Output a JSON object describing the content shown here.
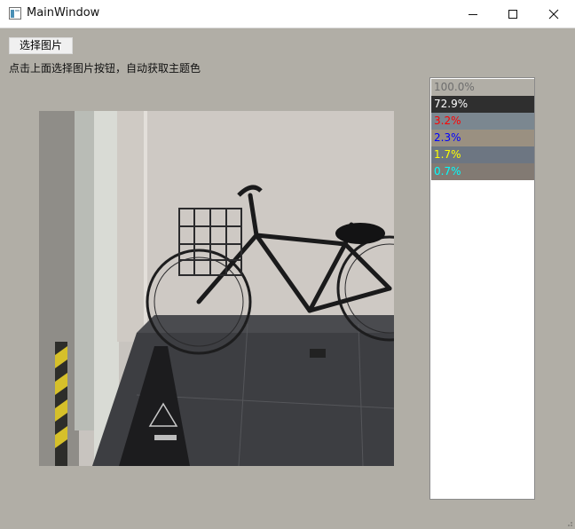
{
  "window": {
    "title": "MainWindow"
  },
  "toolbar": {
    "choose_image_label": "选择图片"
  },
  "hint_text": "点击上面选择图片按钮，自动获取主题色",
  "palette": [
    {
      "percent": "100.0%",
      "background": "#b1aea6",
      "text_color": "#6e6e6e"
    },
    {
      "percent": "72.9%",
      "background": "#2f2f2f",
      "text_color": "#ffffff"
    },
    {
      "percent": "3.2%",
      "background": "#7b8790",
      "text_color": "#ff0000"
    },
    {
      "percent": "2.3%",
      "background": "#9a9081",
      "text_color": "#0000ff"
    },
    {
      "percent": "1.7%",
      "background": "#6d7682",
      "text_color": "#ffff00"
    },
    {
      "percent": "0.7%",
      "background": "#827a73",
      "text_color": "#00ffff"
    }
  ],
  "colors": {
    "window_background": "#b1aea6",
    "palette_panel_background": "#ffffff"
  },
  "icons": {
    "app": "app-window-icon",
    "minimize": "minimize-icon",
    "maximize": "maximize-icon",
    "close": "close-icon"
  }
}
